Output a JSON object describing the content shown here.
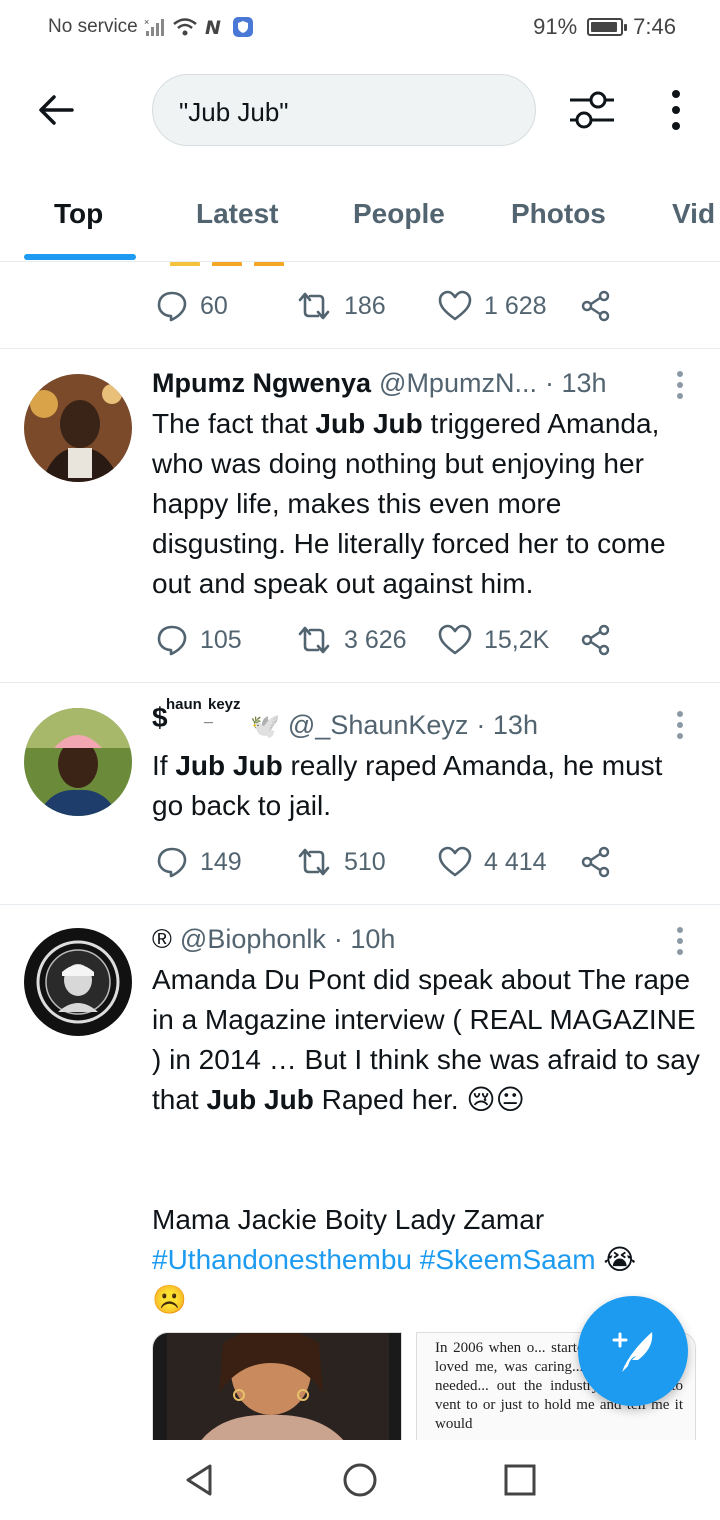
{
  "status_bar": {
    "carrier": "No service",
    "battery": "91%",
    "battery_level": 0.91,
    "time": "7:46"
  },
  "header": {
    "search_query": "\"Jub Jub\""
  },
  "tabs": [
    {
      "label": "Top",
      "active": true
    },
    {
      "label": "Latest",
      "active": false
    },
    {
      "label": "People",
      "active": false
    },
    {
      "label": "Photos",
      "active": false
    },
    {
      "label": "Vid",
      "active": false
    }
  ],
  "partial_tweet": {
    "replies": "60",
    "retweets": "186",
    "likes": "1 628"
  },
  "tweets": [
    {
      "name": "Mpumz Ngwenya",
      "handle": "@MpumzN...",
      "time": "· 13h",
      "text_parts": [
        "The fact that ",
        "Jub Jub",
        " triggered Amanda, who was doing nothing but enjoying her happy life, makes this even more disgusting. He literally forced her to come out and speak out against him."
      ],
      "replies": "105",
      "retweets": "3 626",
      "likes": "15,2K"
    },
    {
      "name_prefix": "$",
      "name_sup1": "haun",
      "name_sup2": "keyz",
      "name_sub": "_",
      "name_emoji": "🕊️",
      "handle": "@_ShaunKeyz",
      "time": "· 13h",
      "text_parts": [
        "If ",
        "Jub Jub",
        " really raped Amanda, he must go back to jail."
      ],
      "replies": "149",
      "retweets": "510",
      "likes": "4 414"
    },
    {
      "name": "®",
      "handle": "@Biophonlk",
      "time": "· 10h",
      "text_parts": [
        "Amanda Du Pont did speak about The rape in a Magazine interview ( REAL MAGAZINE ) in 2014 … But I think she was afraid to say that ",
        "Jub Jub",
        " Raped her.  😢😐"
      ],
      "text_line2": "Mama Jackie Boity Lady Zamar",
      "hashtags": [
        "#Uthandonesthembu",
        "#SkeemSaam"
      ],
      "hashtag_emoji": "😭",
      "last_emoji": "☹️",
      "media_text": "In 2006 when o... started off we were... loved me, was caring... my needs. If I needed... out the industry, someone to vent to or just to hold me and tell me it would"
    }
  ],
  "colors": {
    "accent": "#1d9bf0",
    "text_primary": "#0f1419",
    "text_secondary": "#536471"
  }
}
